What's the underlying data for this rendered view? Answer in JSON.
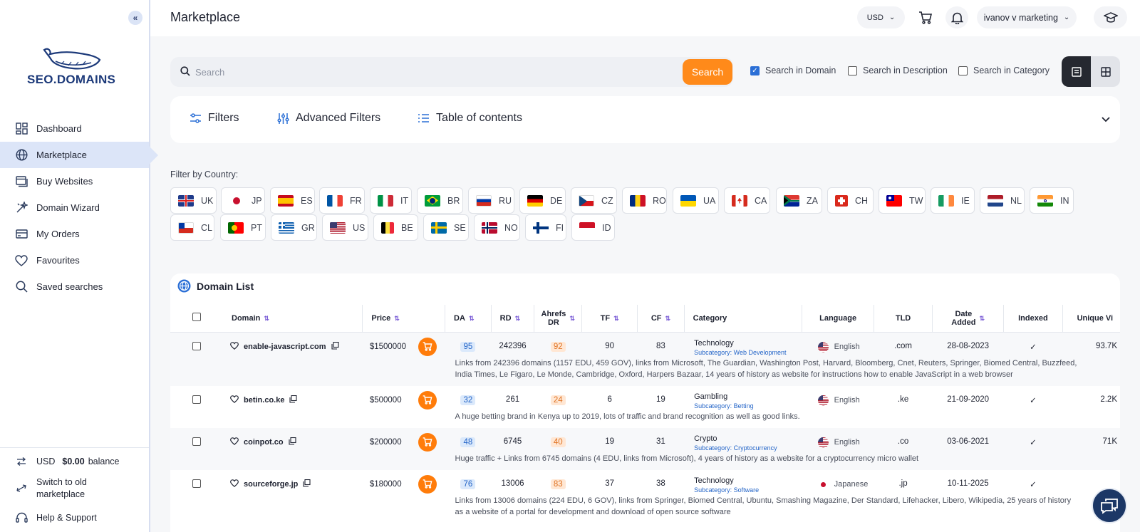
{
  "app": {
    "logo_text": "SEO.DOMAINS",
    "page_title": "Marketplace"
  },
  "sidebar": {
    "items": [
      {
        "label": "Dashboard",
        "icon": "dashboard-icon"
      },
      {
        "label": "Marketplace",
        "icon": "globe-icon"
      },
      {
        "label": "Buy Websites",
        "icon": "browser-icon"
      },
      {
        "label": "Domain Wizard",
        "icon": "wand-icon"
      },
      {
        "label": "My Orders",
        "icon": "card-icon"
      },
      {
        "label": "Favourites",
        "icon": "heart-icon"
      },
      {
        "label": "Saved searches",
        "icon": "search-icon"
      }
    ],
    "balance_currency": "USD",
    "balance_amount": "$0.00",
    "balance_label": "balance",
    "switch_label": "Switch to old marketplace",
    "help_label": "Help & Support"
  },
  "header": {
    "currency": "USD",
    "user": "ivanov v marketing"
  },
  "search": {
    "placeholder": "Search",
    "button": "Search",
    "options": [
      {
        "label": "Search in Domain",
        "checked": true
      },
      {
        "label": "Search in Description",
        "checked": false
      },
      {
        "label": "Search in Category",
        "checked": false
      }
    ]
  },
  "filters": {
    "tabs": [
      "Filters",
      "Advanced Filters",
      "Table of contents"
    ]
  },
  "countries": {
    "label": "Filter by Country:",
    "list": [
      "UK",
      "JP",
      "ES",
      "FR",
      "IT",
      "BR",
      "RU",
      "DE",
      "CZ",
      "RO",
      "UA",
      "CA",
      "ZA",
      "CH",
      "TW",
      "IE",
      "NL",
      "IN",
      "CL",
      "PT",
      "GR",
      "US",
      "BE",
      "SE",
      "NO",
      "FI",
      "ID"
    ]
  },
  "domain_list": {
    "title": "Domain List",
    "columns": {
      "domain": "Domain",
      "price": "Price",
      "da": "DA",
      "rd": "RD",
      "dr_line1": "Ahrefs",
      "dr_line2": "DR",
      "tf": "TF",
      "cf": "CF",
      "category": "Category",
      "language": "Language",
      "tld": "TLD",
      "date_line1": "Date",
      "date_line2": "Added",
      "indexed": "Indexed",
      "unique": "Unique Vi"
    },
    "rows": [
      {
        "domain": "enable-javascript.com",
        "price": "$1500000",
        "da": "95",
        "rd": "242396",
        "dr": "92",
        "tf": "90",
        "cf": "83",
        "category": "Technology",
        "subcategory": "Subcategory: Web Development",
        "language": "English",
        "tld": ".com",
        "date": "28-08-2023",
        "indexed": "✓",
        "unique": "93.7K",
        "description": "Links from 242396 domains (1157 EDU, 459 GOV), links from Microsoft, The Guardian, Washington Post, Harvard, Bloomberg, Cnet, Reuters, Springer, Biomed Central, Buzzfeed, India Times, Le Figaro, Le Monde, Cambridge, Oxford, Harpers Bazaar, 14 years of history as website for instructions how to enable JavaScript in a web browser"
      },
      {
        "domain": "betin.co.ke",
        "price": "$500000",
        "da": "32",
        "rd": "261",
        "dr": "24",
        "tf": "6",
        "cf": "19",
        "category": "Gambling",
        "subcategory": "Subcategory: Betting",
        "language": "English",
        "tld": ".ke",
        "date": "21-09-2020",
        "indexed": "✓",
        "unique": "2.2K",
        "description": "A huge betting brand in Kenya up to 2019, lots of traffic and brand recognition as well as good links."
      },
      {
        "domain": "coinpot.co",
        "price": "$200000",
        "da": "48",
        "rd": "6745",
        "dr": "40",
        "tf": "19",
        "cf": "31",
        "category": "Crypto",
        "subcategory": "Subcategory: Cryptocurrency",
        "language": "English",
        "tld": ".co",
        "date": "03-06-2021",
        "indexed": "✓",
        "unique": "71K",
        "description": "Huge traffic + Links from 6745 domains (4 EDU, links from Microsoft), 4 years of history as a website for a cryptocurrency micro wallet"
      },
      {
        "domain": "sourceforge.jp",
        "price": "$180000",
        "da": "76",
        "rd": "13006",
        "dr": "83",
        "tf": "37",
        "cf": "38",
        "category": "Technology",
        "subcategory": "Subcategory: Software",
        "language": "Japanese",
        "tld": ".jp",
        "date": "10-11-2025",
        "indexed": "✓",
        "unique": "",
        "description": "Links from 13006 domains (224 EDU, 6 GOV), links from Springer, Biomed Central, Ubuntu, Smashing Magazine, Der Standard, Lifehacker, Libero, Wikipedia, 25 years of history as a website of a portal for development and download of open source software"
      }
    ]
  }
}
